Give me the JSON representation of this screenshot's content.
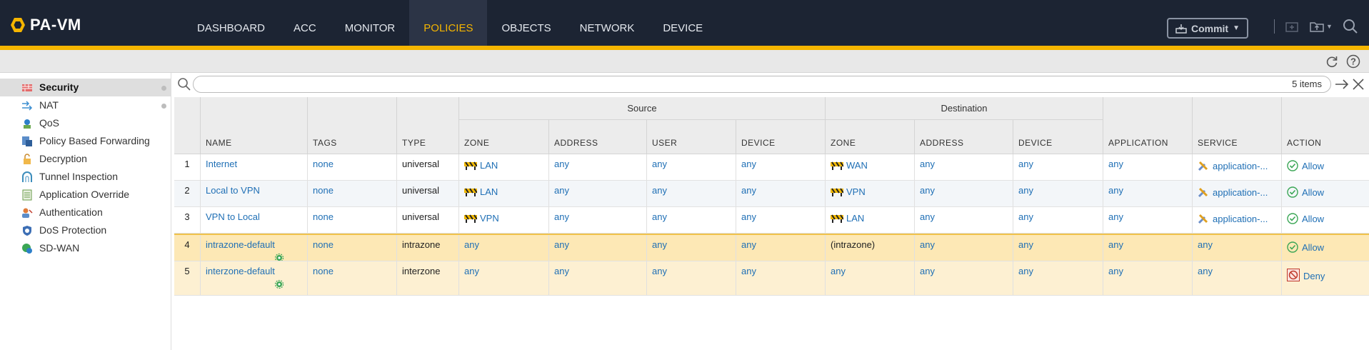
{
  "app": {
    "title": "PA-VM"
  },
  "nav": {
    "items": [
      "DASHBOARD",
      "ACC",
      "MONITOR",
      "POLICIES",
      "OBJECTS",
      "NETWORK",
      "DEVICE"
    ],
    "active": "POLICIES"
  },
  "toolbar": {
    "commit_label": "Commit"
  },
  "sidebar": {
    "items": [
      {
        "label": "Security",
        "icon": "security-rule-icon",
        "active": true
      },
      {
        "label": "NAT",
        "icon": "nat-icon"
      },
      {
        "label": "QoS",
        "icon": "qos-icon"
      },
      {
        "label": "Policy Based Forwarding",
        "icon": "pbf-icon"
      },
      {
        "label": "Decryption",
        "icon": "lock-icon"
      },
      {
        "label": "Tunnel Inspection",
        "icon": "tunnel-icon"
      },
      {
        "label": "Application Override",
        "icon": "app-override-icon"
      },
      {
        "label": "Authentication",
        "icon": "authentication-icon"
      },
      {
        "label": "DoS Protection",
        "icon": "dos-shield-icon"
      },
      {
        "label": "SD-WAN",
        "icon": "sdwan-icon"
      }
    ]
  },
  "search": {
    "value": "",
    "placeholder": "",
    "count": "5 items"
  },
  "table": {
    "groups": {
      "source": "Source",
      "destination": "Destination"
    },
    "headers": {
      "name": "NAME",
      "tags": "TAGS",
      "type": "TYPE",
      "src_zone": "ZONE",
      "src_address": "ADDRESS",
      "src_user": "USER",
      "src_device": "DEVICE",
      "dst_zone": "ZONE",
      "dst_address": "ADDRESS",
      "dst_device": "DEVICE",
      "application": "APPLICATION",
      "service": "SERVICE",
      "action": "ACTION"
    },
    "rows": [
      {
        "num": "1",
        "name": "Internet",
        "tags": "none",
        "type": "universal",
        "src_zone": "LAN",
        "src_address": "any",
        "src_user": "any",
        "src_device": "any",
        "dst_zone": "WAN",
        "dst_address": "any",
        "dst_device": "any",
        "application": "any",
        "service": "application-...",
        "action": "Allow"
      },
      {
        "num": "2",
        "name": "Local to VPN",
        "tags": "none",
        "type": "universal",
        "src_zone": "LAN",
        "src_address": "any",
        "src_user": "any",
        "src_device": "any",
        "dst_zone": "VPN",
        "dst_address": "any",
        "dst_device": "any",
        "application": "any",
        "service": "application-...",
        "action": "Allow"
      },
      {
        "num": "3",
        "name": "VPN to Local",
        "tags": "none",
        "type": "universal",
        "src_zone": "VPN",
        "src_address": "any",
        "src_user": "any",
        "src_device": "any",
        "dst_zone": "LAN",
        "dst_address": "any",
        "dst_device": "any",
        "application": "any",
        "service": "application-...",
        "action": "Allow"
      },
      {
        "num": "4",
        "name": "intrazone-default",
        "tags": "none",
        "type": "intrazone",
        "src_zone": "any",
        "src_address": "any",
        "src_user": "any",
        "src_device": "any",
        "dst_zone": "(intrazone)",
        "dst_address": "any",
        "dst_device": "any",
        "application": "any",
        "service": "any",
        "action": "Allow"
      },
      {
        "num": "5",
        "name": "interzone-default",
        "tags": "none",
        "type": "interzone",
        "src_zone": "any",
        "src_address": "any",
        "src_user": "any",
        "src_device": "any",
        "dst_zone": "any",
        "dst_address": "any",
        "dst_device": "any",
        "application": "any",
        "service": "any",
        "action": "Deny"
      }
    ]
  },
  "colors": {
    "nav_bg": "#1c2433",
    "accent": "#f5b500",
    "link": "#1f6fb5",
    "allow": "#3aa655",
    "deny": "#c0392b"
  }
}
